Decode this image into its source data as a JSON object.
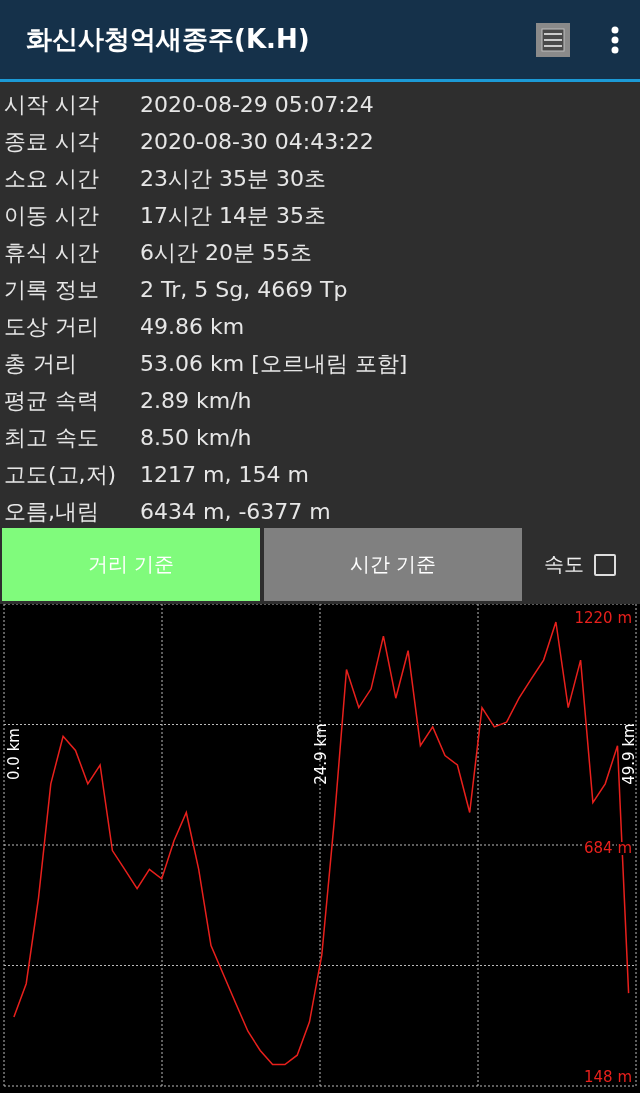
{
  "header": {
    "title": "화신사청억새종주(K.H)"
  },
  "stats": [
    {
      "label": "시작 시각",
      "value": "2020-08-29 05:07:24"
    },
    {
      "label": "종료 시각",
      "value": "2020-08-30 04:43:22"
    },
    {
      "label": "소요 시간",
      "value": "23시간 35분 30초"
    },
    {
      "label": "이동 시간",
      "value": "17시간 14분 35초"
    },
    {
      "label": "휴식 시간",
      "value": "6시간 20분 55초"
    },
    {
      "label": "기록 정보",
      "value": "2 Tr, 5 Sg, 4669 Tp"
    },
    {
      "label": "도상 거리",
      "value": "49.86 km"
    },
    {
      "label": "총 거리",
      "value": "53.06 km [오르내림 포함]"
    },
    {
      "label": "평균 속력",
      "value": "2.89 km/h"
    },
    {
      "label": "최고 속도",
      "value": "8.50 km/h"
    },
    {
      "label": "고도(고,저)",
      "value": "1217 m, 154 m"
    },
    {
      "label": "오름,내림",
      "value": "6434 m, -6377 m"
    }
  ],
  "modes": [
    {
      "label": "거리 기준",
      "selected": true
    },
    {
      "label": "시간 기준",
      "selected": false
    }
  ],
  "speed_toggle": {
    "label": "속도",
    "checked": false
  },
  "chart": {
    "chart_data": {
      "type": "line",
      "x": [
        0,
        1,
        2,
        3,
        4,
        5,
        6,
        7,
        8,
        9,
        10,
        11,
        12,
        13,
        14,
        15,
        16,
        17,
        18,
        19,
        20,
        21,
        22,
        23,
        24,
        25,
        26,
        27,
        28,
        29,
        30,
        31,
        32,
        33,
        34,
        35,
        36,
        37,
        38,
        39,
        40,
        41,
        42,
        43,
        44,
        45,
        46,
        47,
        48,
        49,
        49.9
      ],
      "series": [
        {
          "color": "#e8201c",
          "values": [
            288,
            366,
            566,
            833,
            944,
            911,
            833,
            877,
            677,
            633,
            588,
            633,
            611,
            700,
            766,
            633,
            455,
            388,
            321,
            255,
            210,
            177,
            177,
            199,
            277,
            433,
            744,
            1100,
            1011,
            1055,
            1178,
            1033,
            1144,
            922,
            966,
            899,
            877,
            766,
            1011,
            966,
            977,
            1033,
            1078,
            1122,
            1211,
            1011,
            1122,
            789,
            833,
            922,
            344
          ]
        }
      ],
      "xlim": [
        -0.8,
        50.5
      ],
      "ylim": [
        127,
        1253
      ],
      "xticks": [
        {
          "value": 0,
          "label": "0.0 km"
        },
        {
          "value": 24.9,
          "label": "24.9 km"
        },
        {
          "value": 49.9,
          "label": "49.9 km"
        }
      ],
      "yticks": [
        {
          "value": 1220,
          "label": "1220 m"
        },
        {
          "value": 684,
          "label": "684 m"
        },
        {
          "value": 148,
          "label": "148 m"
        }
      ]
    }
  }
}
